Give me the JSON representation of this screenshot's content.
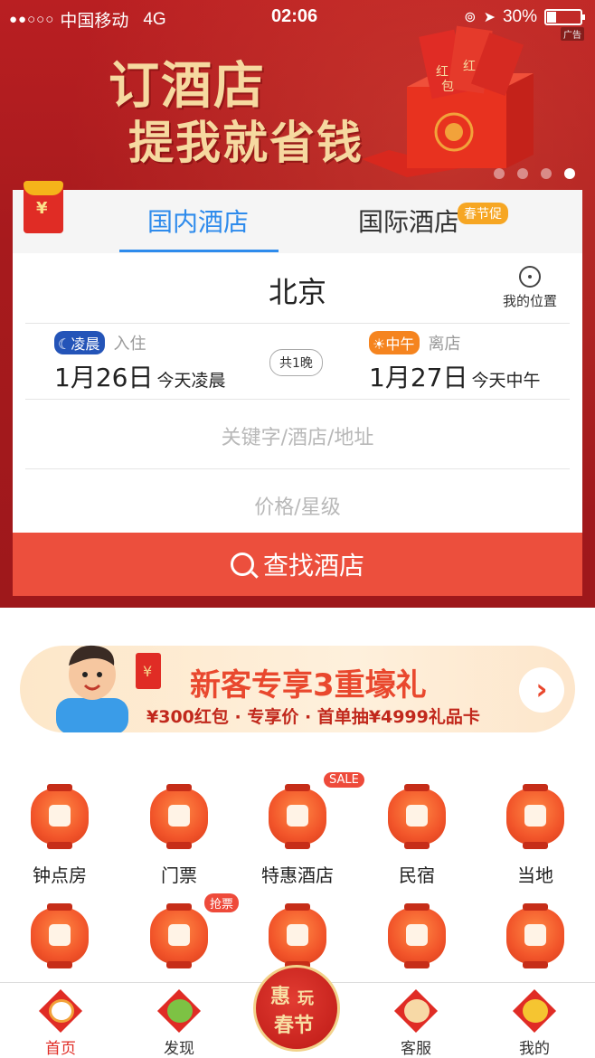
{
  "status_bar": {
    "signal": "●●○○○",
    "carrier": "中国移动",
    "network": "4G",
    "time": "02:06",
    "battery": "30%"
  },
  "hero": {
    "ad_tag": "广告",
    "slogan_line1": "订酒店",
    "slogan_line2": "提我就省钱",
    "gift_char1": "红",
    "gift_char2": "包",
    "gift_char3": "红"
  },
  "search_card": {
    "redpack_symbol": "¥",
    "tabs": [
      {
        "label": "国内酒店"
      },
      {
        "label": "国际酒店"
      }
    ],
    "promo_badge": "春节促",
    "city": "北京",
    "location_label": "我的位置",
    "checkin": {
      "tag": "凌晨",
      "label": "入住",
      "date": "1月26日",
      "note": "今天凌晨"
    },
    "nights": "共1晚",
    "checkout": {
      "tag": "中午",
      "label": "离店",
      "date": "1月27日",
      "note": "今天中午"
    },
    "keyword_placeholder": "关键字/酒店/地址",
    "price_placeholder": "价格/星级",
    "search_button": "查找酒店"
  },
  "promo_banner": {
    "title": "新客专享3重壕礼",
    "subtitle": "¥300红包 · 专享价 · 首单抽¥4999礼品卡",
    "arrow": "›",
    "hongbao_symbol": "¥"
  },
  "grid": {
    "row1": [
      {
        "label": "钟点房",
        "icon": "clock-icon"
      },
      {
        "label": "门票",
        "icon": "ticket-icon"
      },
      {
        "label": "特惠酒店",
        "icon": "tag-icon"
      },
      {
        "label": "民宿",
        "icon": "house-icon"
      },
      {
        "label": "当地",
        "icon": "map-pin-icon"
      }
    ],
    "row2_icons": [
      "plane-icon",
      "train-icon",
      "bus-icon",
      "document-icon",
      "crossroad-icon"
    ],
    "sale_badge": "SALE",
    "grab_badge": "抢票"
  },
  "tabbar": {
    "items": [
      {
        "label": "首页"
      },
      {
        "label": "发现"
      },
      {
        "label": "客服"
      },
      {
        "label": "我的"
      }
    ],
    "center_line1_a": "惠",
    "center_line1_b": "玩",
    "center_line2": "春节"
  },
  "colors": {
    "hero_red": "#b91f22",
    "accent_blue": "#2e8bec",
    "button_red": "#ec4f3d",
    "badge_orange": "#f6a623"
  }
}
